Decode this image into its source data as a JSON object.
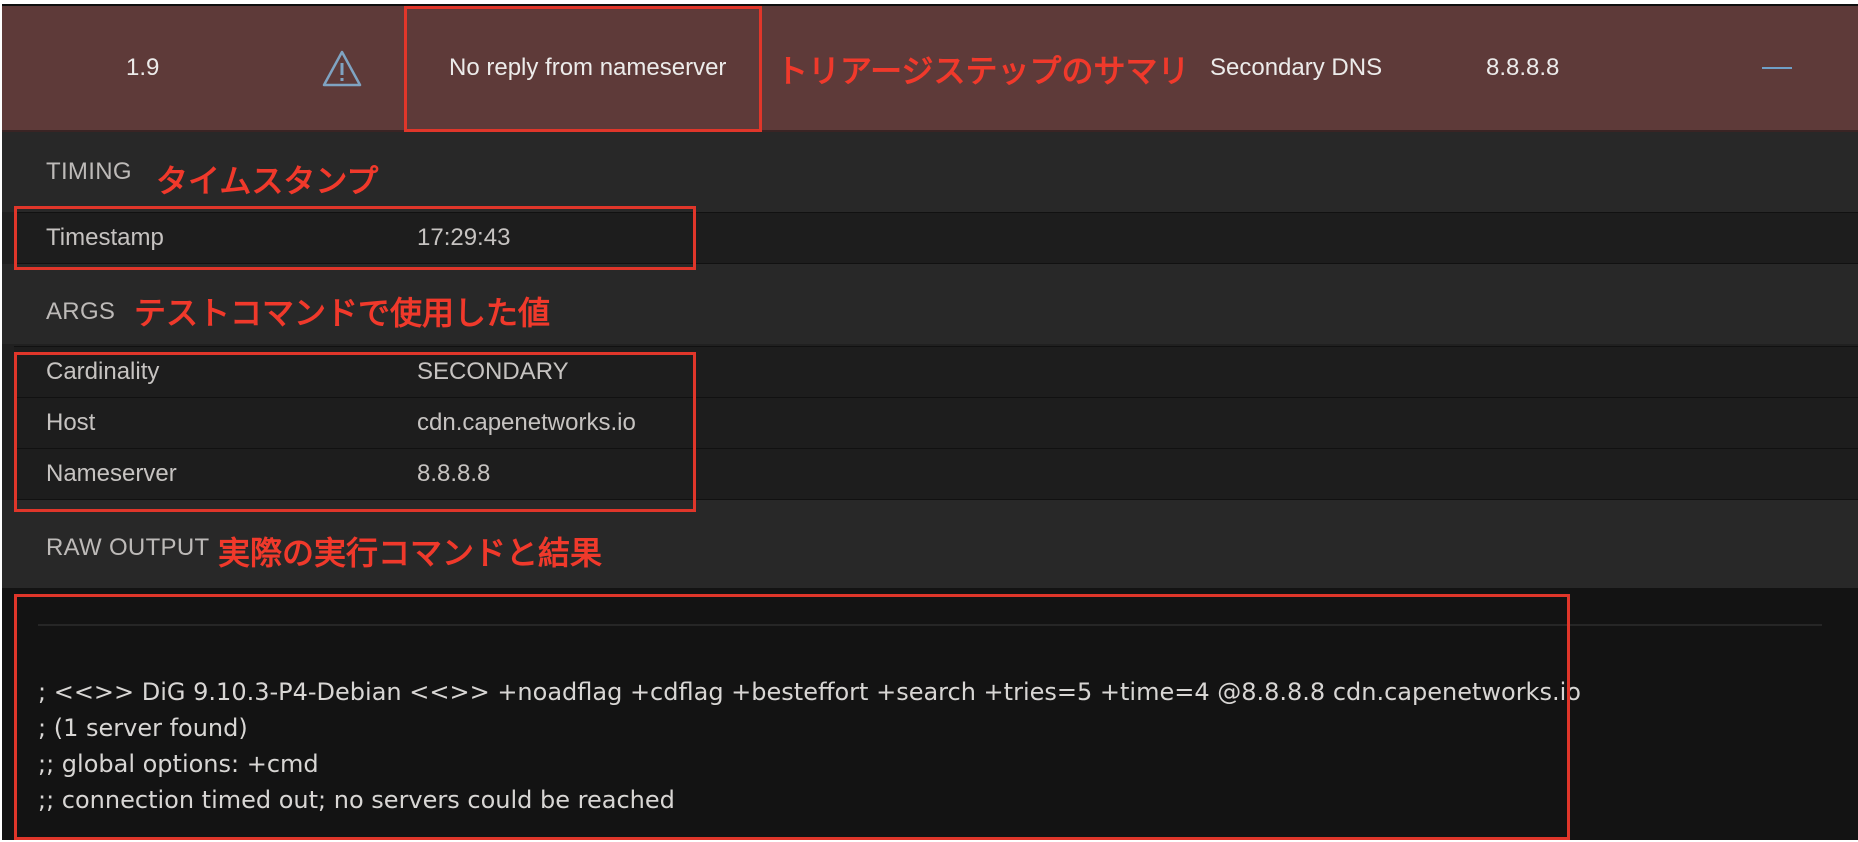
{
  "summary": {
    "score": "1.9",
    "status_icon": "warning-icon",
    "message": "No reply from nameserver",
    "name": "Secondary DNS",
    "address": "8.8.8.8",
    "toggle_icon": "collapse-dash-icon"
  },
  "timing": {
    "header": "TIMING",
    "rows": [
      {
        "key": "Timestamp",
        "value": "17:29:43"
      }
    ]
  },
  "args": {
    "header": "ARGS",
    "rows": [
      {
        "key": "Cardinality",
        "value": "SECONDARY"
      },
      {
        "key": "Host",
        "value": "cdn.capenetworks.io"
      },
      {
        "key": "Nameserver",
        "value": "8.8.8.8"
      }
    ]
  },
  "raw_output": {
    "header": "RAW OUTPUT",
    "lines": [
      "; <<>> DiG 9.10.3-P4-Debian <<>> +noadflag +cdflag +besteffort +search +tries=5 +time=4 @8.8.8.8 cdn.capenetworks.io",
      "; (1 server found)",
      ";; global options: +cmd",
      ";; connection timed out; no servers could be reached"
    ]
  },
  "annotations": {
    "summary": "トリアージステップのサマリ",
    "timing": "タイムスタンプ",
    "args": "テストコマンドで使用した値",
    "raw_output": "実際の実行コマンドと結果",
    "color": "#e0362a"
  },
  "colors": {
    "summary_bg": "#5e3a39",
    "panel_bg": "#202020",
    "raw_bg": "#131313",
    "accent": "#6f9fc7"
  }
}
